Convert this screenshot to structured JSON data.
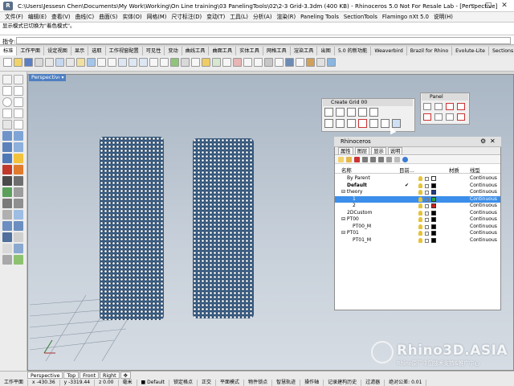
{
  "window": {
    "title": "C:\\Users\\Jessesn Chen\\Documents\\My Work\\Working\\On Line training\\03 PanelingTools\\02\\2-3 Grid-3.3dm (400 KB) - Rhinoceros 5.0 Not For Resale Lab - [Perspective]",
    "app_icon": "R",
    "min": "─",
    "max": "□",
    "close": "✕"
  },
  "menu": [
    "文件(F)",
    "编辑(E)",
    "查看(V)",
    "曲线(C)",
    "曲面(S)",
    "实体(O)",
    "网格(M)",
    "尺寸标注(D)",
    "变动(T)",
    "工具(L)",
    "分析(A)",
    "渲染(R)",
    "Paneling Tools",
    "SectionTools",
    "Flamingo nXt 5.0",
    "说明(H)"
  ],
  "command": {
    "history": "显示模式已切换为\"着色模式\"。",
    "prompt": "指令:",
    "value": ""
  },
  "toolbar_tabs": [
    "标准",
    "工作平面",
    "设定视图",
    "显示",
    "选取",
    "工作视窗配置",
    "可见性",
    "变动",
    "曲线工具",
    "曲面工具",
    "实体工具",
    "网格工具",
    "渲染工具",
    "出图",
    "5.0 的新功能",
    "Weaverbird",
    "Brazil for Rhino",
    "Evolute-Lite",
    "Sections"
  ],
  "viewport": {
    "label": "Perspective",
    "label_arrow": "▾"
  },
  "view_tabs": [
    "Perspective",
    "Top",
    "Front",
    "Right",
    "✥"
  ],
  "floating_panels": {
    "create_grid": {
      "title": "Create Grid 00"
    },
    "panel": {
      "title": "Panel"
    }
  },
  "rhino_panel": {
    "title": "Rhinoceros",
    "tabs": [
      "属性",
      "图层",
      "显示",
      "说明"
    ],
    "columns": {
      "name": "名称",
      "current": "目前...",
      "material": "材质",
      "linetype": "线型"
    },
    "layers": [
      {
        "name": "By Parent",
        "current": "",
        "linetype": "Continuous",
        "indent": 1,
        "selected": false,
        "bold": false,
        "color": "#ffffff"
      },
      {
        "name": "Default",
        "current": "✔",
        "linetype": "Continuous",
        "indent": 1,
        "selected": false,
        "bold": true,
        "color": "#000000"
      },
      {
        "name": "⊟ theory",
        "current": "",
        "linetype": "Continuous",
        "indent": 0,
        "selected": false,
        "bold": false,
        "color": "#1f3b8a"
      },
      {
        "name": "1",
        "current": "",
        "linetype": "Continuous",
        "indent": 2,
        "selected": true,
        "bold": false,
        "color": "#22aa44"
      },
      {
        "name": "2",
        "current": "",
        "linetype": "Continuous",
        "indent": 2,
        "selected": false,
        "bold": false,
        "color": "#cc2222"
      },
      {
        "name": "2DCustom",
        "current": "",
        "linetype": "Continuous",
        "indent": 1,
        "selected": false,
        "bold": false,
        "color": "#000000"
      },
      {
        "name": "⊟ PT00",
        "current": "",
        "linetype": "Continuous",
        "indent": 0,
        "selected": false,
        "bold": false,
        "color": "#000000"
      },
      {
        "name": "PT00_M",
        "current": "",
        "linetype": "Continuous",
        "indent": 2,
        "selected": false,
        "bold": false,
        "color": "#000000"
      },
      {
        "name": "⊟ PT01",
        "current": "",
        "linetype": "Continuous",
        "indent": 0,
        "selected": false,
        "bold": false,
        "color": "#000000"
      },
      {
        "name": "PT01_M",
        "current": "",
        "linetype": "Continuous",
        "indent": 2,
        "selected": false,
        "bold": false,
        "color": "#000000"
      }
    ]
  },
  "status": [
    "工作平面",
    "x -430.36",
    "y -3319.44",
    "z 0.00",
    "毫米",
    "■ Default",
    "锁定格点",
    "正交",
    "平面模式",
    "物件锁点",
    "智慧轨迹",
    "操作轴",
    "记录建构历史",
    "过滤器",
    "绝对公差: 0.01"
  ],
  "watermark": {
    "main": "Rhino3D.ASIA",
    "sub": "Rhino原厂中国技术支持&推广中心"
  },
  "colors": {
    "accent_blue": "#4e7fc2",
    "selected_row": "#3b8eea",
    "tower_fill": "#3a5f87"
  }
}
